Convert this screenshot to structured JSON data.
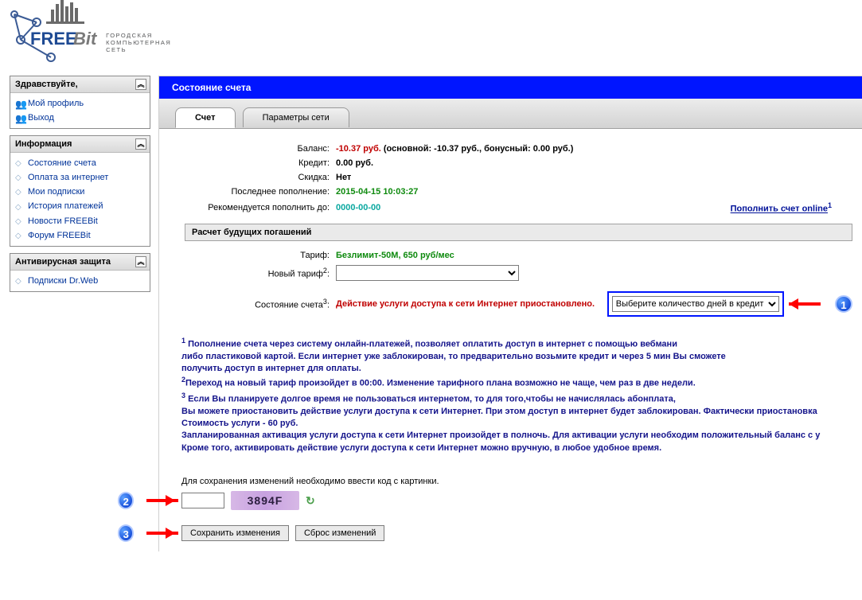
{
  "logo": {
    "line1": "ГОРОДСКАЯ",
    "line2": "КОМПЬЮТЕРНАЯ",
    "line3": "СЕТЬ"
  },
  "sidebar": {
    "block1": {
      "title": "Здравствуйте,",
      "items": [
        "Мой профиль",
        "Выход"
      ]
    },
    "block2": {
      "title": "Информация",
      "items": [
        "Состояние счета",
        "Оплата за интернет",
        "Мои подписки",
        "История платежей",
        "Новости FREEBit",
        "Форум FREEBit"
      ]
    },
    "block3": {
      "title": "Антивирусная защита",
      "items": [
        "Подписки Dr.Web"
      ]
    }
  },
  "page": {
    "title": "Состояние счета"
  },
  "tabs": {
    "t1": "Счет",
    "t2": "Параметры сети"
  },
  "rows": {
    "balance_lbl": "Баланс:",
    "balance_val": "-10.37 руб.",
    "balance_extra": "(основной: -10.37 руб., бонусный: 0.00 руб.)",
    "credit_lbl": "Кредит:",
    "credit_val": "0.00 руб.",
    "discount_lbl": "Скидка:",
    "discount_val": "Нет",
    "last_lbl": "Последнее пополнение:",
    "last_val": "2015-04-15 10:03:27",
    "recommend_lbl": "Рекомендуется пополнить до:",
    "recommend_val": "0000-00-00",
    "online_link": "Пополнить счет online",
    "sup1": "1",
    "calc_hdr": "Расчет будущих погашений",
    "tariff_lbl": "Тариф:",
    "tariff_val": "Безлимит-50М, 650 руб/мес",
    "newtariff_lbl": "Новый тариф",
    "sup2": "2",
    "colon2": ":",
    "status_lbl": "Состояние счета",
    "sup3": "3",
    "colon3": ":",
    "status_val": "Действие услуги доступа к сети Интернет приостановлено.",
    "credit_select": "Выберите количество дней в кредит"
  },
  "badges": {
    "b1": "1",
    "b2": "2",
    "b3": "3"
  },
  "notes": {
    "n1a": " Пополнение счета через систему онлайн-платежей, позволяет оплатить доступ в интернет с помощью вебмани",
    "n1b": "либо пластиковой картой. Если интернет уже заблокирован, то предварительно возьмите кредит и через 5 мин Вы сможете",
    "n1c": "получить доступ в интернет для оплаты.",
    "n2": "Переход на новый тариф произойдет в 00:00. Изменение тарифного плана возможно не чаще, чем раз в две недели.",
    "n3a": " Если Вы планируете долгое время не пользоваться интернетом, то для того,чтобы не начислялась абонплата,",
    "n3b": "Вы можете приостановить действие услуги доступа к сети Интернет. При этом доступ в интернет будет заблокирован. Фактически приостановка",
    "n3c": "Стоимость услуги - 60 руб.",
    "n3d": "Запланированная активация услуги доступа к сети Интернет произойдет в полночь. Для активации услуги необходим положительный баланс с у",
    "n3e": "Кроме того, активировать действие услуги доступа к сети Интернет можно вручную, в любое удобное время."
  },
  "captcha": {
    "label": "Для сохранения изменений необходимо ввести код с картинки.",
    "code": "3894F"
  },
  "buttons": {
    "save": "Сохранить изменения",
    "reset": "Сброс изменений"
  }
}
